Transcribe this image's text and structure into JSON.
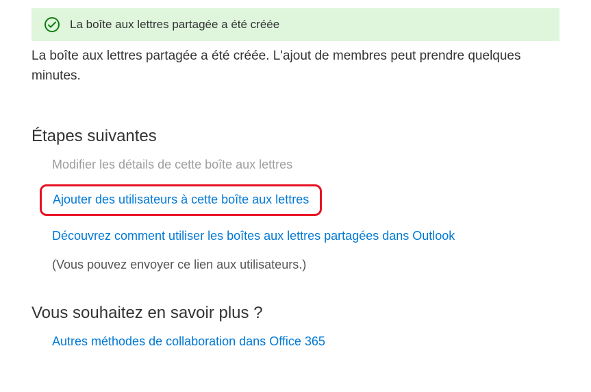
{
  "banner": {
    "icon": "checkmark-circle",
    "message": "La boîte aux lettres partagée a été créée"
  },
  "description": "La boîte aux lettres partagée a été créée. L'ajout de membres peut prendre quelques minutes.",
  "nextSteps": {
    "title": "Étapes suivantes",
    "editDetails": "Modifier les détails de cette boîte aux lettres",
    "addUsers": "Ajouter des utilisateurs à cette boîte aux lettres",
    "learnShared": "Découvrez comment utiliser les boîtes aux lettres partagées dans Outlook",
    "sendLinkNote": "(Vous pouvez envoyer ce lien aux utilisateurs.)"
  },
  "learnMore": {
    "title": "Vous souhaitez en savoir plus ?",
    "otherMethods": "Autres méthodes de collaboration dans Office 365"
  }
}
